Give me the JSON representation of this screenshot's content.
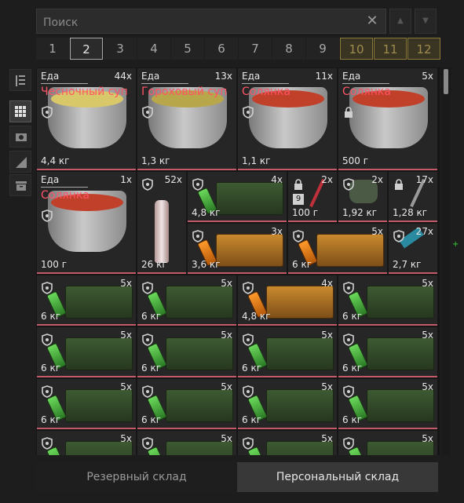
{
  "search": {
    "placeholder": "Поиск",
    "value": ""
  },
  "pages": {
    "items": [
      "1",
      "2",
      "3",
      "4",
      "5",
      "6",
      "7",
      "8",
      "9",
      "10",
      "11",
      "12"
    ],
    "active_index": 1,
    "locked": [
      "10",
      "11",
      "12"
    ]
  },
  "side_tools": [
    "columns-icon",
    "grid-icon",
    "camera-icon",
    "ruler-icon",
    "archive-icon"
  ],
  "items": [
    {
      "cat": "Еда",
      "qty": "44x",
      "name": "Чесночный суп",
      "weight": "4,4 кг",
      "kind": "pot",
      "soup": "#d9c86a",
      "lock": false
    },
    {
      "cat": "Еда",
      "qty": "13x",
      "name": "Гороховый суп",
      "weight": "1,3 кг",
      "kind": "pot",
      "soup": "#b8a64a",
      "lock": false
    },
    {
      "cat": "Еда",
      "qty": "11x",
      "name": "Солянка",
      "weight": "1,1 кг",
      "kind": "pot",
      "soup": "#c0402a",
      "lock": false
    },
    {
      "cat": "Еда",
      "qty": "5x",
      "name": "Солянка",
      "weight": "500 г",
      "kind": "pot",
      "soup": "#c0402a",
      "lock": true
    },
    {
      "cat": "Еда",
      "qty": "1x",
      "name": "Солянка",
      "weight": "100 г",
      "kind": "pot",
      "soup": "#c0402a",
      "lock": false
    },
    {
      "cat": "",
      "qty": "52x",
      "name": "",
      "weight": "26 кг",
      "kind": "bottle",
      "lock": false
    },
    {
      "cat": "",
      "qty": "4x",
      "name": "",
      "weight": "4,8 кг",
      "kind": "greenbox",
      "lock": false
    },
    {
      "cat": "",
      "qty": "2x",
      "name": "",
      "weight": "100 г",
      "kind": "stick",
      "lock": true,
      "level": "9"
    },
    {
      "cat": "",
      "qty": "2x",
      "name": "",
      "weight": "1,92 кг",
      "kind": "bag",
      "lock": false
    },
    {
      "cat": "",
      "qty": "17x",
      "name": "",
      "weight": "1,28 кг",
      "kind": "rod",
      "lock": true
    },
    {
      "cat": "",
      "qty": "3x",
      "name": "",
      "weight": "3,6 кг",
      "kind": "orangebox",
      "lock": false
    },
    {
      "cat": "",
      "qty": "5x",
      "name": "",
      "weight": "6 кг",
      "kind": "orangebox",
      "lock": false
    },
    {
      "cat": "",
      "qty": "27x",
      "name": "",
      "weight": "2,7 кг",
      "kind": "tool",
      "lock": false
    },
    {
      "cat": "",
      "qty": "5x",
      "name": "",
      "weight": "6 кг",
      "kind": "greenbox"
    },
    {
      "cat": "",
      "qty": "5x",
      "name": "",
      "weight": "6 кг",
      "kind": "greenbox"
    },
    {
      "cat": "",
      "qty": "4x",
      "name": "",
      "weight": "4,8 кг",
      "kind": "orangebox"
    },
    {
      "cat": "",
      "qty": "5x",
      "name": "",
      "weight": "6 кг",
      "kind": "greenbox"
    },
    {
      "cat": "",
      "qty": "5x",
      "name": "",
      "weight": "6 кг",
      "kind": "greenbox"
    },
    {
      "cat": "",
      "qty": "5x",
      "name": "",
      "weight": "6 кг",
      "kind": "greenbox"
    },
    {
      "cat": "",
      "qty": "5x",
      "name": "",
      "weight": "6 кг",
      "kind": "greenbox"
    },
    {
      "cat": "",
      "qty": "5x",
      "name": "",
      "weight": "6 кг",
      "kind": "greenbox"
    },
    {
      "cat": "",
      "qty": "5x",
      "name": "",
      "weight": "6 кг",
      "kind": "greenbox"
    },
    {
      "cat": "",
      "qty": "5x",
      "name": "",
      "weight": "6 кг",
      "kind": "greenbox"
    },
    {
      "cat": "",
      "qty": "5x",
      "name": "",
      "weight": "6 кг",
      "kind": "greenbox"
    },
    {
      "cat": "",
      "qty": "5x",
      "name": "",
      "weight": "6 кг",
      "kind": "greenbox"
    },
    {
      "cat": "",
      "qty": "5x",
      "name": "",
      "weight": "",
      "kind": "greenbox"
    },
    {
      "cat": "",
      "qty": "5x",
      "name": "",
      "weight": "",
      "kind": "greenbox"
    },
    {
      "cat": "",
      "qty": "5x",
      "name": "",
      "weight": "",
      "kind": "greenbox"
    },
    {
      "cat": "",
      "qty": "5x",
      "name": "",
      "weight": "",
      "kind": "greenbox"
    }
  ],
  "bottom_tabs": {
    "reserve": "Резервный склад",
    "personal": "Персональный склад",
    "active": "personal"
  },
  "colors": {
    "name_red": "#ff5466",
    "underline": "#c25a6a",
    "locked_page": "#a08c4e"
  }
}
